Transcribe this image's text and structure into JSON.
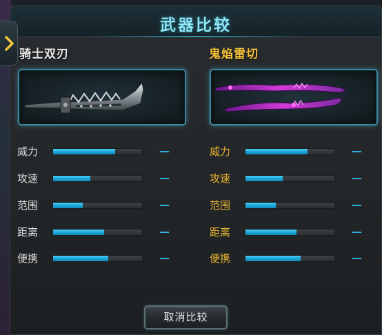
{
  "window": {
    "title": "武器比较"
  },
  "left_weapon": {
    "name": "骑士双刃",
    "stats": [
      {
        "label": "威力",
        "level": 0.7,
        "diff": "—"
      },
      {
        "label": "攻速",
        "level": 0.42,
        "diff": "—"
      },
      {
        "label": "范围",
        "level": 0.33,
        "diff": "—"
      },
      {
        "label": "距离",
        "level": 0.57,
        "diff": "—"
      },
      {
        "label": "便携",
        "level": 0.62,
        "diff": "—"
      }
    ]
  },
  "right_weapon": {
    "name": "鬼焰雷切",
    "stats": [
      {
        "label": "威力",
        "level": 0.7,
        "diff": "—"
      },
      {
        "label": "攻速",
        "level": 0.42,
        "diff": "—"
      },
      {
        "label": "范围",
        "level": 0.34,
        "diff": "—"
      },
      {
        "label": "距离",
        "level": 0.57,
        "diff": "—"
      },
      {
        "label": "便携",
        "level": 0.62,
        "diff": "—"
      }
    ]
  },
  "actions": {
    "cancel_label": "取消比较"
  },
  "icons": {
    "side_tab": "chevron-right-icon",
    "left_image": "knight-dual-blade-icon",
    "right_image": "ghost-flame-lightning-blade-icon"
  },
  "colors": {
    "title": "#8fe6f7",
    "left_name": "#e8e8e8",
    "right_name": "#f2c23a",
    "bar_fill": "#19a3d6",
    "frame_border": "#3b8aa1"
  }
}
